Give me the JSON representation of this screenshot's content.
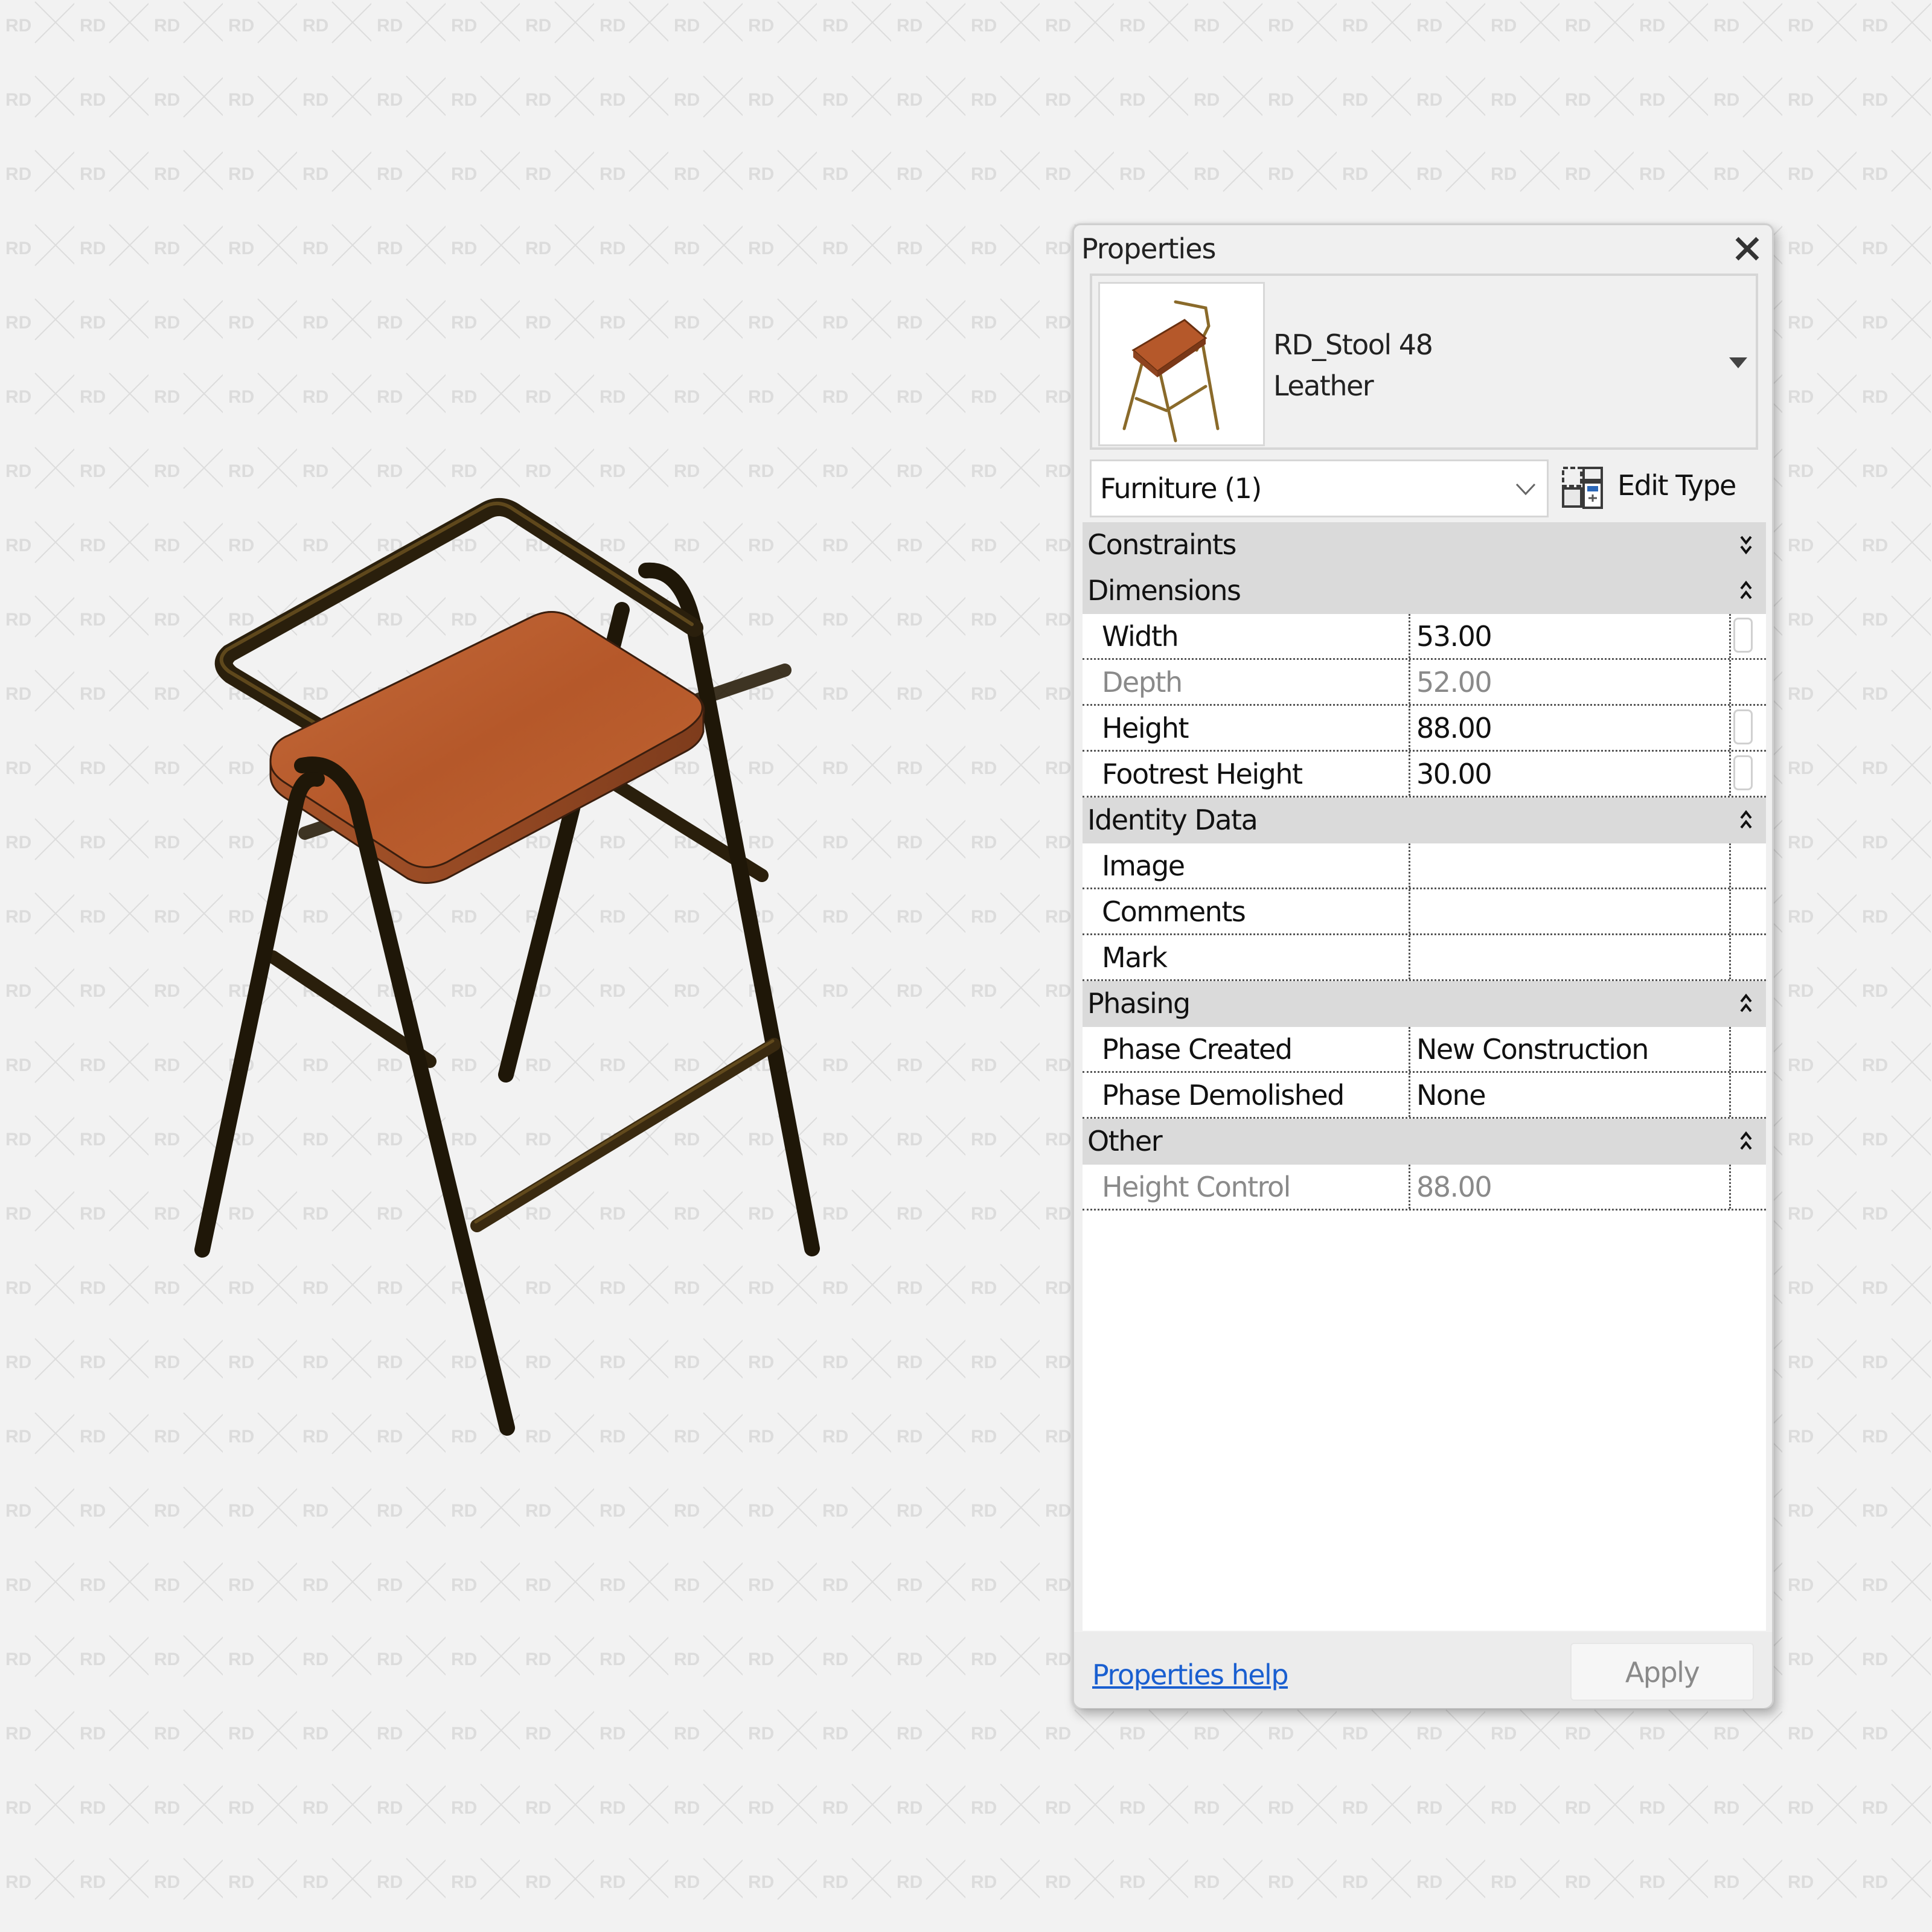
{
  "watermark": {
    "text": "RD"
  },
  "viewport": {
    "model": {
      "name": "bar-stool-3d-view",
      "colors": {
        "frame": "#2a1f0c",
        "frame_highlight": "#8a6a2a",
        "seat": "#b85a2c",
        "seat_edge": "#8e4420"
      }
    }
  },
  "properties_panel": {
    "title": "Properties",
    "close_icon": "close-icon",
    "type_selector": {
      "family": "RD_Stool 48",
      "type": "Leather",
      "dropdown_icon": "triangle-down-icon"
    },
    "category_filter": {
      "label": "Furniture (1)",
      "icon": "chevron-down-icon"
    },
    "edit_type": {
      "label": "Edit Type",
      "icon": "edit-type-icon"
    },
    "groups": [
      {
        "label": "Constraints",
        "expanded": false,
        "rows": []
      },
      {
        "label": "Dimensions",
        "expanded": true,
        "rows": [
          {
            "name": "Width",
            "value": "53.00",
            "disabled": false,
            "has_param_box": true
          },
          {
            "name": "Depth",
            "value": "52.00",
            "disabled": true,
            "has_param_box": false
          },
          {
            "name": "Height",
            "value": "88.00",
            "disabled": false,
            "has_param_box": true
          },
          {
            "name": "Footrest Height",
            "value": "30.00",
            "disabled": false,
            "has_param_box": true
          }
        ]
      },
      {
        "label": "Identity Data",
        "expanded": true,
        "rows": [
          {
            "name": "Image",
            "value": "",
            "disabled": false,
            "has_param_box": false
          },
          {
            "name": "Comments",
            "value": "",
            "disabled": false,
            "has_param_box": false
          },
          {
            "name": "Mark",
            "value": "",
            "disabled": false,
            "has_param_box": false
          }
        ]
      },
      {
        "label": "Phasing",
        "expanded": true,
        "rows": [
          {
            "name": "Phase Created",
            "value": "New Construction",
            "disabled": false,
            "has_param_box": false
          },
          {
            "name": "Phase Demolished",
            "value": "None",
            "disabled": false,
            "has_param_box": false
          }
        ]
      },
      {
        "label": "Other",
        "expanded": true,
        "rows": [
          {
            "name": "Height Control",
            "value": "88.00",
            "disabled": true,
            "has_param_box": false
          }
        ]
      }
    ],
    "footer": {
      "help_link": "Properties help",
      "apply_label": "Apply",
      "apply_enabled": false
    }
  }
}
